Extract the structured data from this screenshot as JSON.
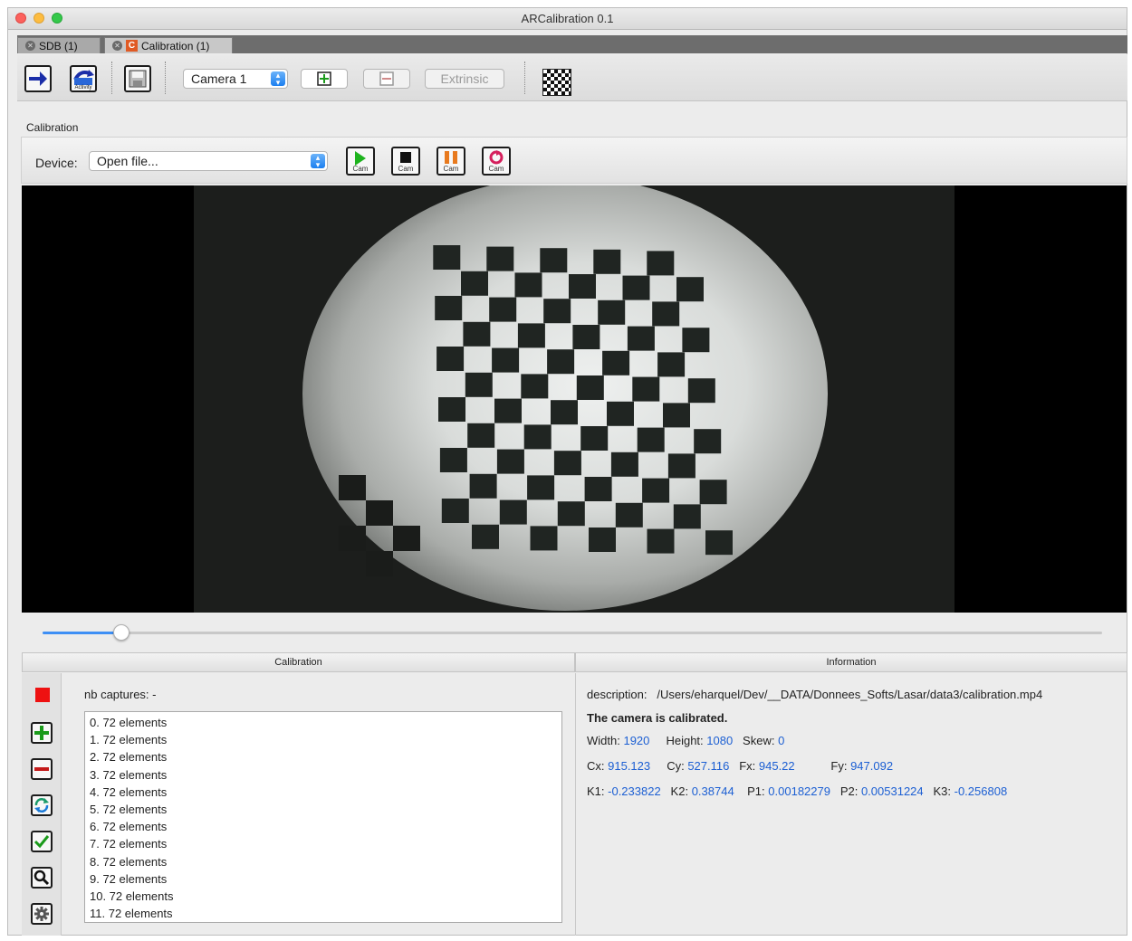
{
  "window": {
    "title": "ARCalibration 0.1"
  },
  "tabs": [
    {
      "label": "SDB (1)"
    },
    {
      "label": "Calibration (1)",
      "icon_letter": "C"
    }
  ],
  "toolbar": {
    "activity_label": "Activity",
    "camera_select": "Camera 1",
    "add_label": "+",
    "remove_label": "−",
    "extrinsic_label": "Extrinsic"
  },
  "calibration_section_label": "Calibration",
  "device": {
    "label": "Device:",
    "select_value": "Open file...",
    "cam_label": "Cam"
  },
  "slider": {
    "value_fraction": 0.074
  },
  "panels": {
    "calibration_header": "Calibration",
    "information_header": "Information"
  },
  "captures": {
    "label": "nb captures:  -",
    "items": [
      "0. 72 elements",
      "1. 72 elements",
      "2. 72 elements",
      "3. 72 elements",
      "4. 72 elements",
      "5. 72 elements",
      "6. 72 elements",
      "7. 72 elements",
      "8. 72 elements",
      "9. 72 elements",
      "10. 72 elements",
      "11. 72 elements"
    ]
  },
  "info": {
    "description_label": "description:",
    "description_value": "/Users/eharquel/Dev/__DATA/Donnees_Softs/Lasar/data3/calibration.mp4",
    "status": "The camera is calibrated.",
    "width_label": "Width:",
    "width_value": "1920",
    "height_label": "Height:",
    "height_value": "1080",
    "skew_label": "Skew:",
    "skew_value": "0",
    "cx_label": "Cx:",
    "cx_value": "915.123",
    "cy_label": "Cy:",
    "cy_value": "527.116",
    "fx_label": "Fx:",
    "fx_value": "945.22",
    "fy_label": "Fy:",
    "fy_value": "947.092",
    "k1_label": "K1:",
    "k1_value": "-0.233822",
    "k2_label": "K2:",
    "k2_value": "0.38744",
    "p1_label": "P1:",
    "p1_value": "0.00182279",
    "p2_label": "P2:",
    "p2_value": "0.00531224",
    "k3_label": "K3:",
    "k3_value": "-0.256808"
  },
  "colors": {
    "accent": "#3d8ff5",
    "value_blue": "#1c5fd3",
    "stop_red": "#ee1111",
    "play_green": "#1eb31e"
  }
}
